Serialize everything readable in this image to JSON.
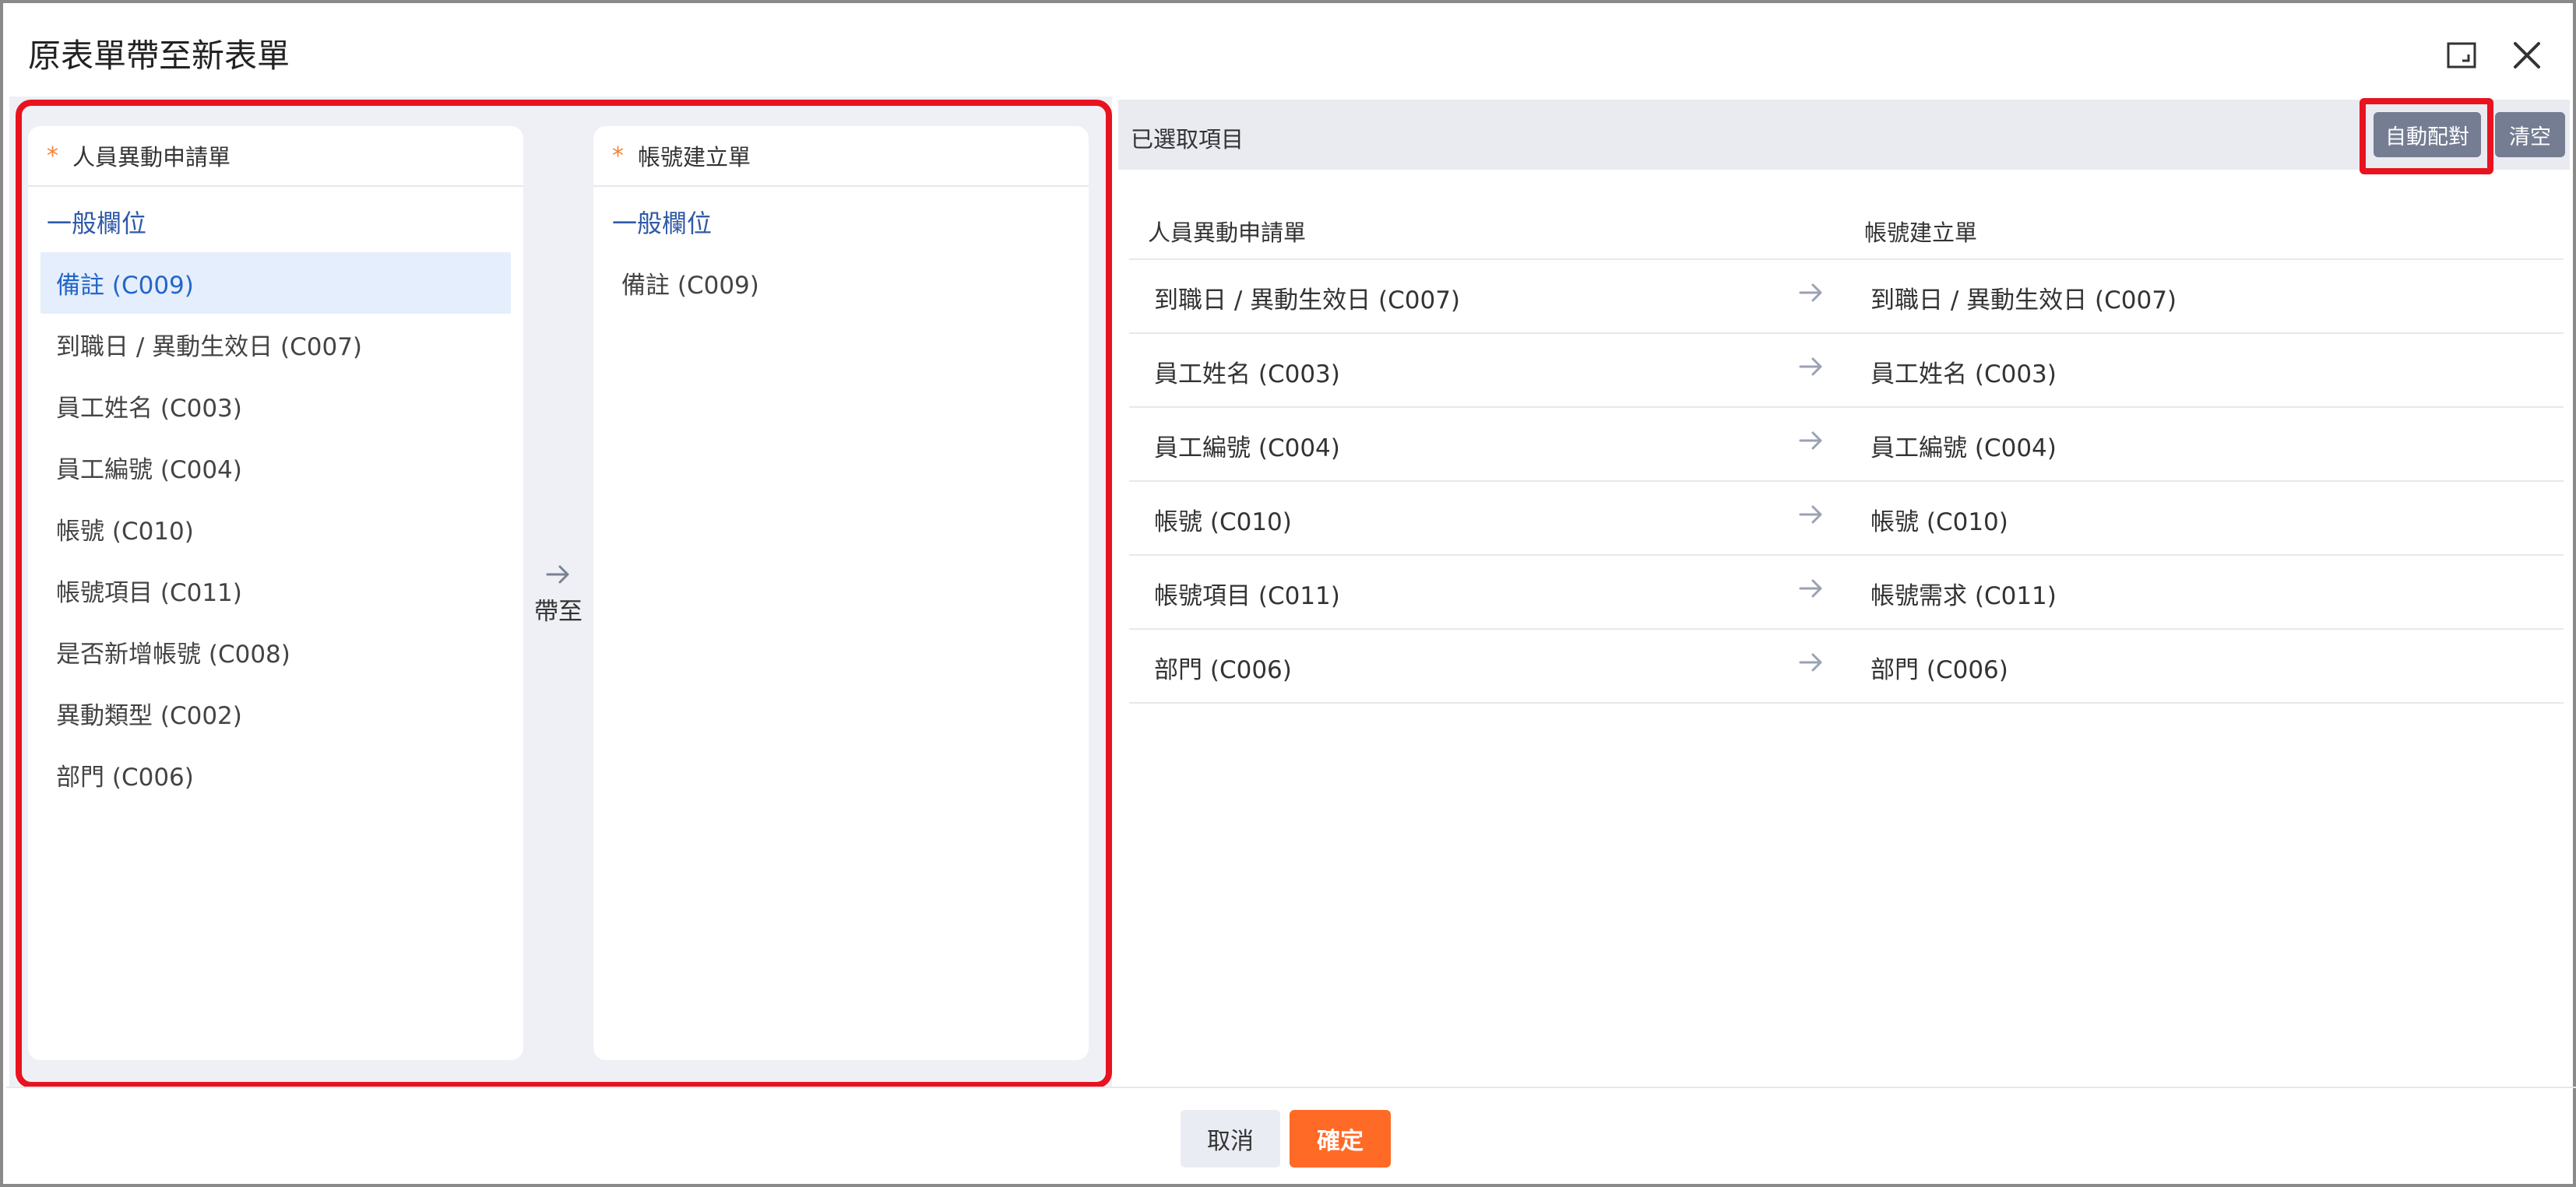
{
  "dialog": {
    "title": "原表單帶至新表單",
    "maximize_icon": "maximize-icon",
    "close_icon": "close-icon"
  },
  "source_panel": {
    "required_mark": "*",
    "title": "人員異動申請單",
    "group_label": "一般欄位",
    "items": [
      {
        "label": "備註 (C009)",
        "selected": true
      },
      {
        "label": "到職日 / 異動生效日 (C007)",
        "selected": false
      },
      {
        "label": "員工姓名 (C003)",
        "selected": false
      },
      {
        "label": "員工編號 (C004)",
        "selected": false
      },
      {
        "label": "帳號 (C010)",
        "selected": false
      },
      {
        "label": "帳號項目 (C011)",
        "selected": false
      },
      {
        "label": "是否新增帳號 (C008)",
        "selected": false
      },
      {
        "label": "異動類型 (C002)",
        "selected": false
      },
      {
        "label": "部門 (C006)",
        "selected": false
      }
    ]
  },
  "transfer": {
    "icon": "arrow-right-icon",
    "label": "帶至"
  },
  "target_panel": {
    "required_mark": "*",
    "title": "帳號建立單",
    "group_label": "一般欄位",
    "items": [
      {
        "label": "備註 (C009)"
      }
    ]
  },
  "selected_panel": {
    "title": "已選取項目",
    "auto_match_label": "自動配對",
    "clear_label": "清空",
    "col_source": "人員異動申請單",
    "col_target": "帳號建立單",
    "rows": [
      {
        "source": "到職日 / 異動生效日 (C007)",
        "target": "到職日 / 異動生效日 (C007)"
      },
      {
        "source": "員工姓名 (C003)",
        "target": "員工姓名 (C003)"
      },
      {
        "source": "員工編號 (C004)",
        "target": "員工編號 (C004)"
      },
      {
        "source": "帳號 (C010)",
        "target": "帳號 (C010)"
      },
      {
        "source": "帳號項目 (C011)",
        "target": "帳號需求 (C011)"
      },
      {
        "source": "部門 (C006)",
        "target": "部門 (C006)"
      }
    ]
  },
  "footer": {
    "cancel_label": "取消",
    "confirm_label": "確定"
  },
  "colors": {
    "accent": "#ff6a26",
    "highlight_frame": "#e8131f",
    "link_blue": "#2f5aa8",
    "selected_bg": "#e5eefc"
  }
}
